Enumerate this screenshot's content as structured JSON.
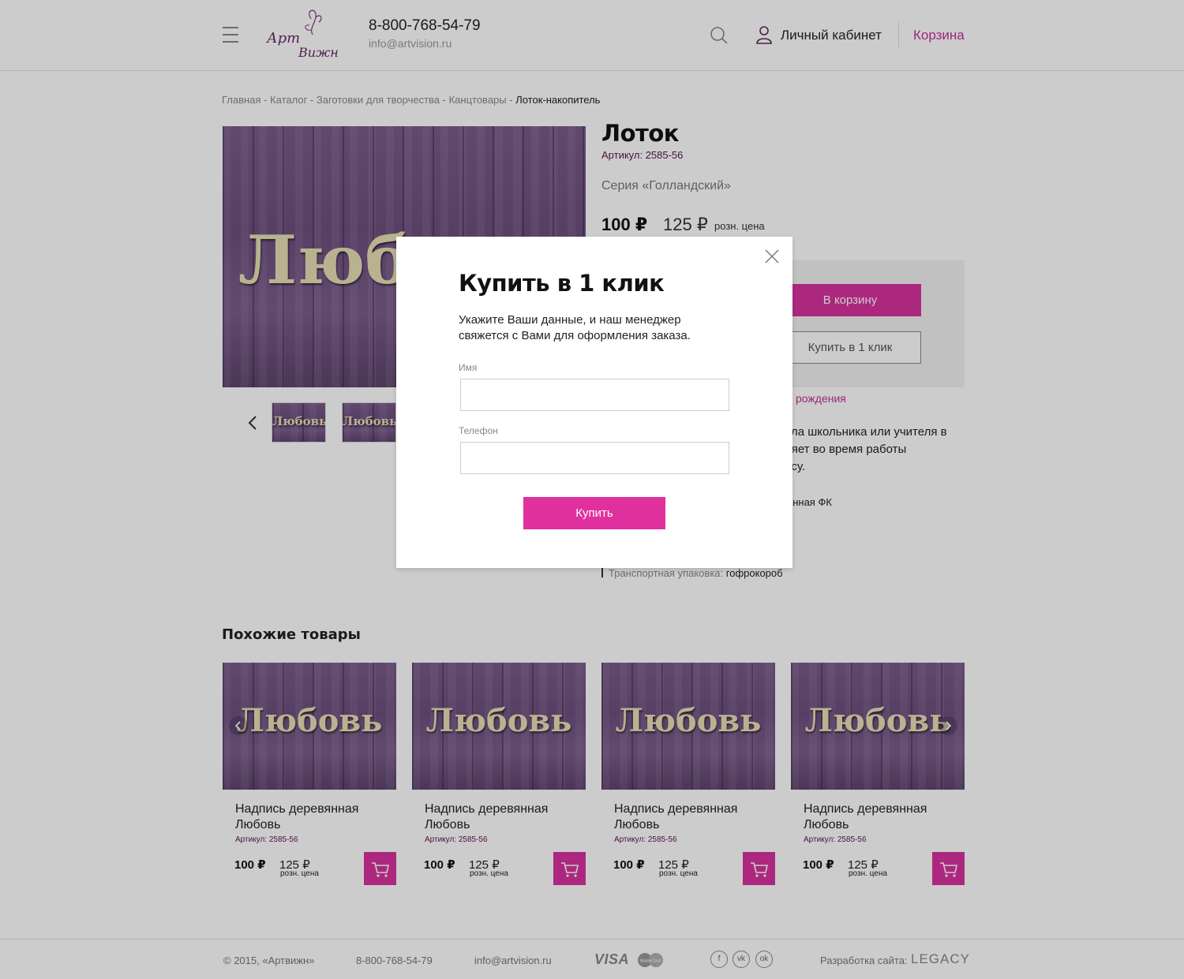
{
  "header": {
    "phone": "8-800-768-54-79",
    "email": "info@artvision.ru",
    "account_label": "Личный кабинет",
    "cart_label": "Корзина",
    "logo_text": "Арт Вижн"
  },
  "breadcrumb": {
    "items": [
      "Главная",
      "Каталог",
      "Заготовки для творчества",
      "Канцтовары"
    ],
    "separator": " - ",
    "current": "Лоток-накопитель"
  },
  "product": {
    "title": "Лоток",
    "sku": "Артикул: 2585-56",
    "series": "Серия «Голландский»",
    "price": "100 ₽",
    "old_price": "125 ₽",
    "old_price_label": "розн. цена",
    "to_cart_label": "В корзину",
    "buy_one_click_label": "Купить в 1 клик",
    "link_fragment": "рождения",
    "description_fragment": "ола школьника или учителя в\nляет во время работы\nесу.",
    "material_fragment": "ованная ФК",
    "pack_label": "Транспортная упаковка:",
    "pack_value": "гофрокороб",
    "image_word": "Любовь"
  },
  "similar": {
    "title": "Похожие товары",
    "items": [
      {
        "name": "Надпись деревянная Любовь",
        "sku": "Артикул: 2585-56",
        "price": "100 ₽",
        "old_price": "125 ₽",
        "old_label": "розн. цена",
        "image_word": "Любовь"
      },
      {
        "name": "Надпись деревянная Любовь",
        "sku": "Артикул: 2585-56",
        "price": "100 ₽",
        "old_price": "125 ₽",
        "old_label": "розн. цена",
        "image_word": "Любовь"
      },
      {
        "name": "Надпись деревянная Любовь",
        "sku": "Артикул: 2585-56",
        "price": "100 ₽",
        "old_price": "125 ₽",
        "old_label": "розн. цена",
        "image_word": "Любовь"
      },
      {
        "name": "Надпись деревянная Любовь",
        "sku": "Артикул: 2585-56",
        "price": "100 ₽",
        "old_price": "125 ₽",
        "old_label": "розн. цена",
        "image_word": "Любовь"
      }
    ]
  },
  "modal": {
    "title": "Купить в 1 клик",
    "text": "Укажите Ваши данные, и наш менеджер свяжется с Вами для оформления заказа.",
    "name_label": "Имя",
    "phone_label": "Телефон",
    "name_value": "",
    "phone_value": "",
    "submit_label": "Купить"
  },
  "footer": {
    "copyright": "© 2015, «Артвижн»",
    "phone": "8-800-768-54-79",
    "email": "info@artvision.ru",
    "visa": "VISA",
    "mastercard": "MasterCard",
    "social": [
      "f",
      "vk",
      "ok"
    ],
    "dev_label": "Разработка сайта:",
    "dev_name": "LEGACY"
  },
  "colors": {
    "accent": "#d8339f",
    "accent_text": "#c2309a",
    "sku": "#5a1650"
  },
  "icons": [
    "menu-icon",
    "search-icon",
    "user-icon",
    "close-icon",
    "chevron-left-icon",
    "chevron-right-icon",
    "cart-icon"
  ]
}
